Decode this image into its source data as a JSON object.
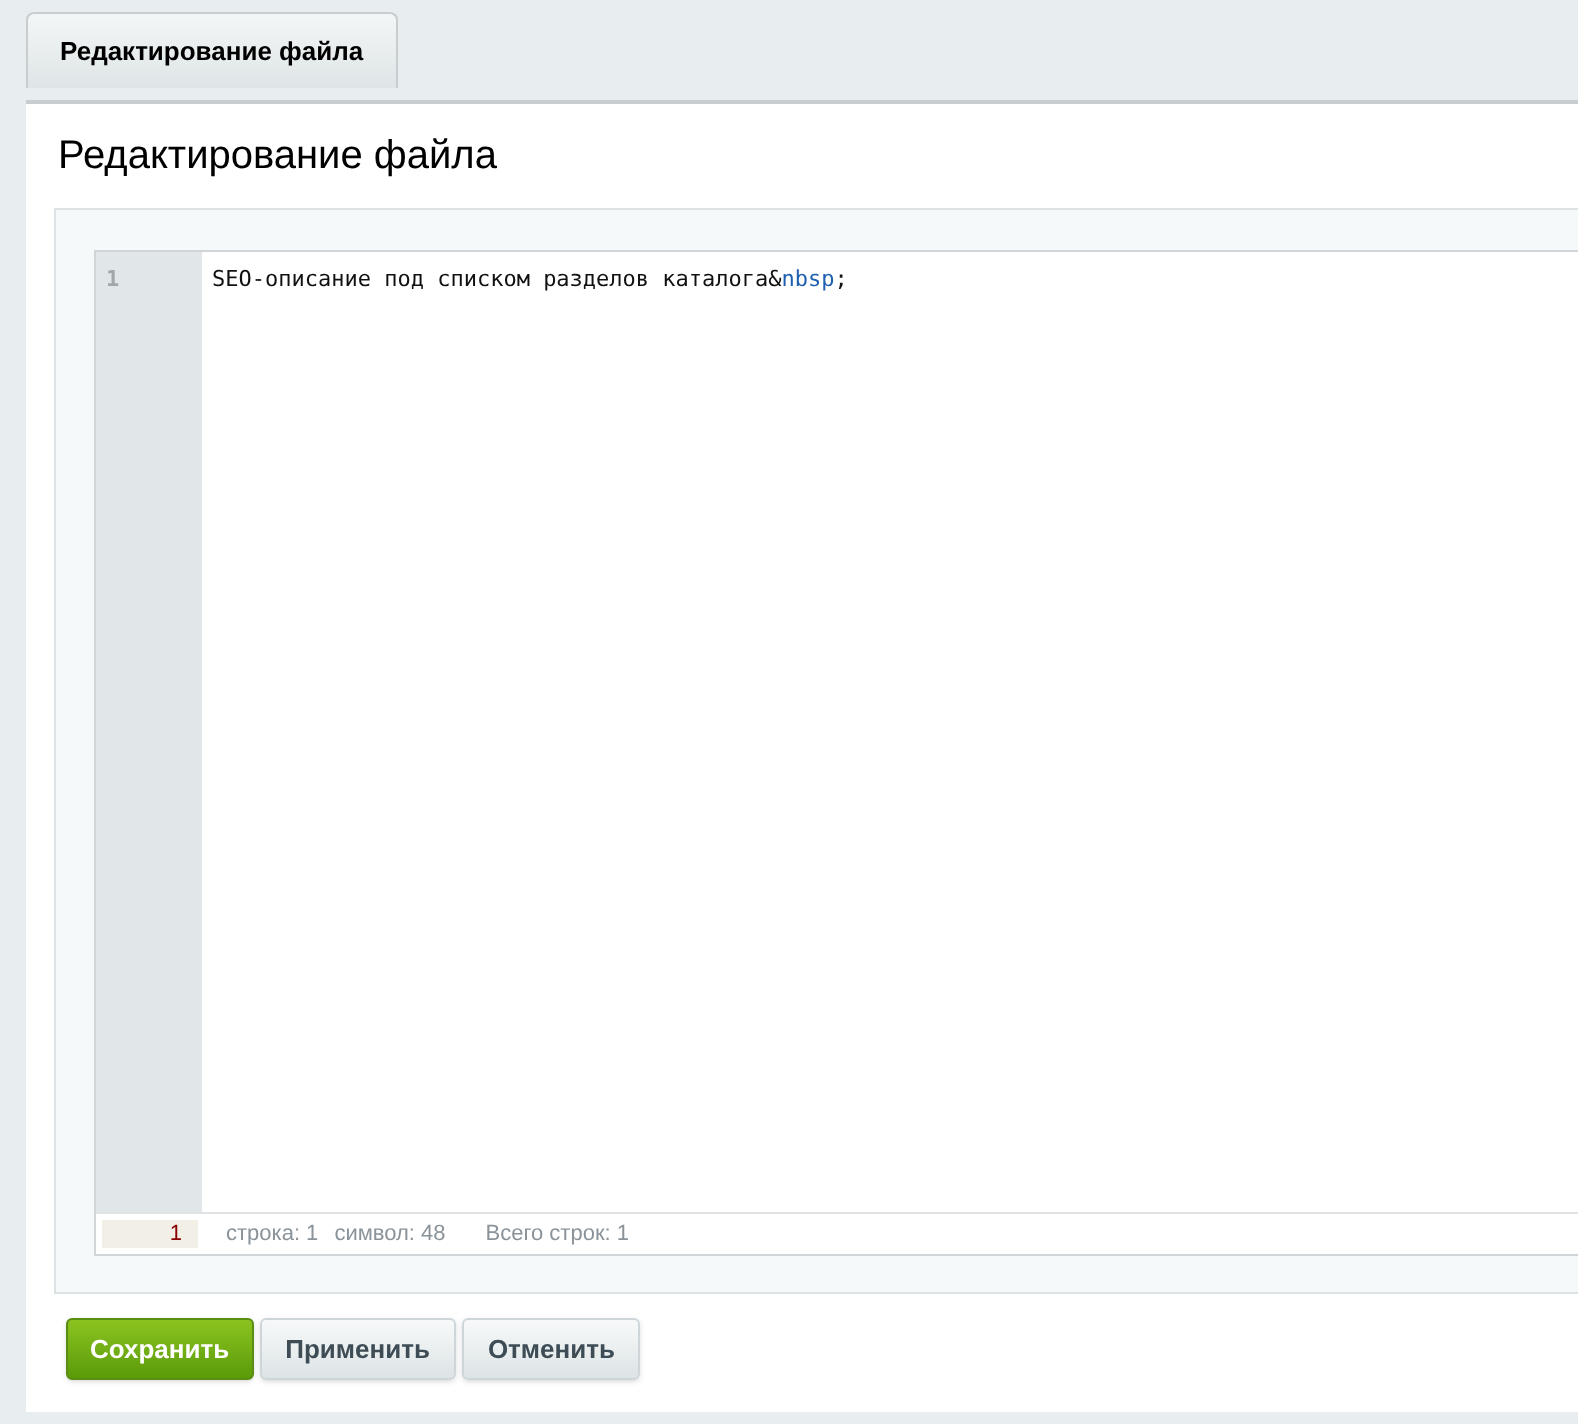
{
  "tabs": [
    {
      "label": "Редактирование файла",
      "selected": true
    }
  ],
  "title": "Редактирование файла",
  "editor": {
    "lines": [
      {
        "number": "1",
        "segments": [
          {
            "text": "SEO-описание под списком разделов каталога",
            "kind": "text"
          },
          {
            "text": "&",
            "kind": "punct"
          },
          {
            "text": "nbsp",
            "kind": "entity"
          },
          {
            "text": ";",
            "kind": "punct"
          }
        ]
      }
    ]
  },
  "status_bar": {
    "line_field": "1",
    "items": [
      "строка: 1",
      "символ: 48",
      "Всего строк: 1"
    ]
  },
  "buttons": [
    {
      "label": "Сохранить",
      "kind": "primary"
    },
    {
      "label": "Применить",
      "kind": "secondary"
    },
    {
      "label": "Отменить",
      "kind": "secondary"
    }
  ]
}
